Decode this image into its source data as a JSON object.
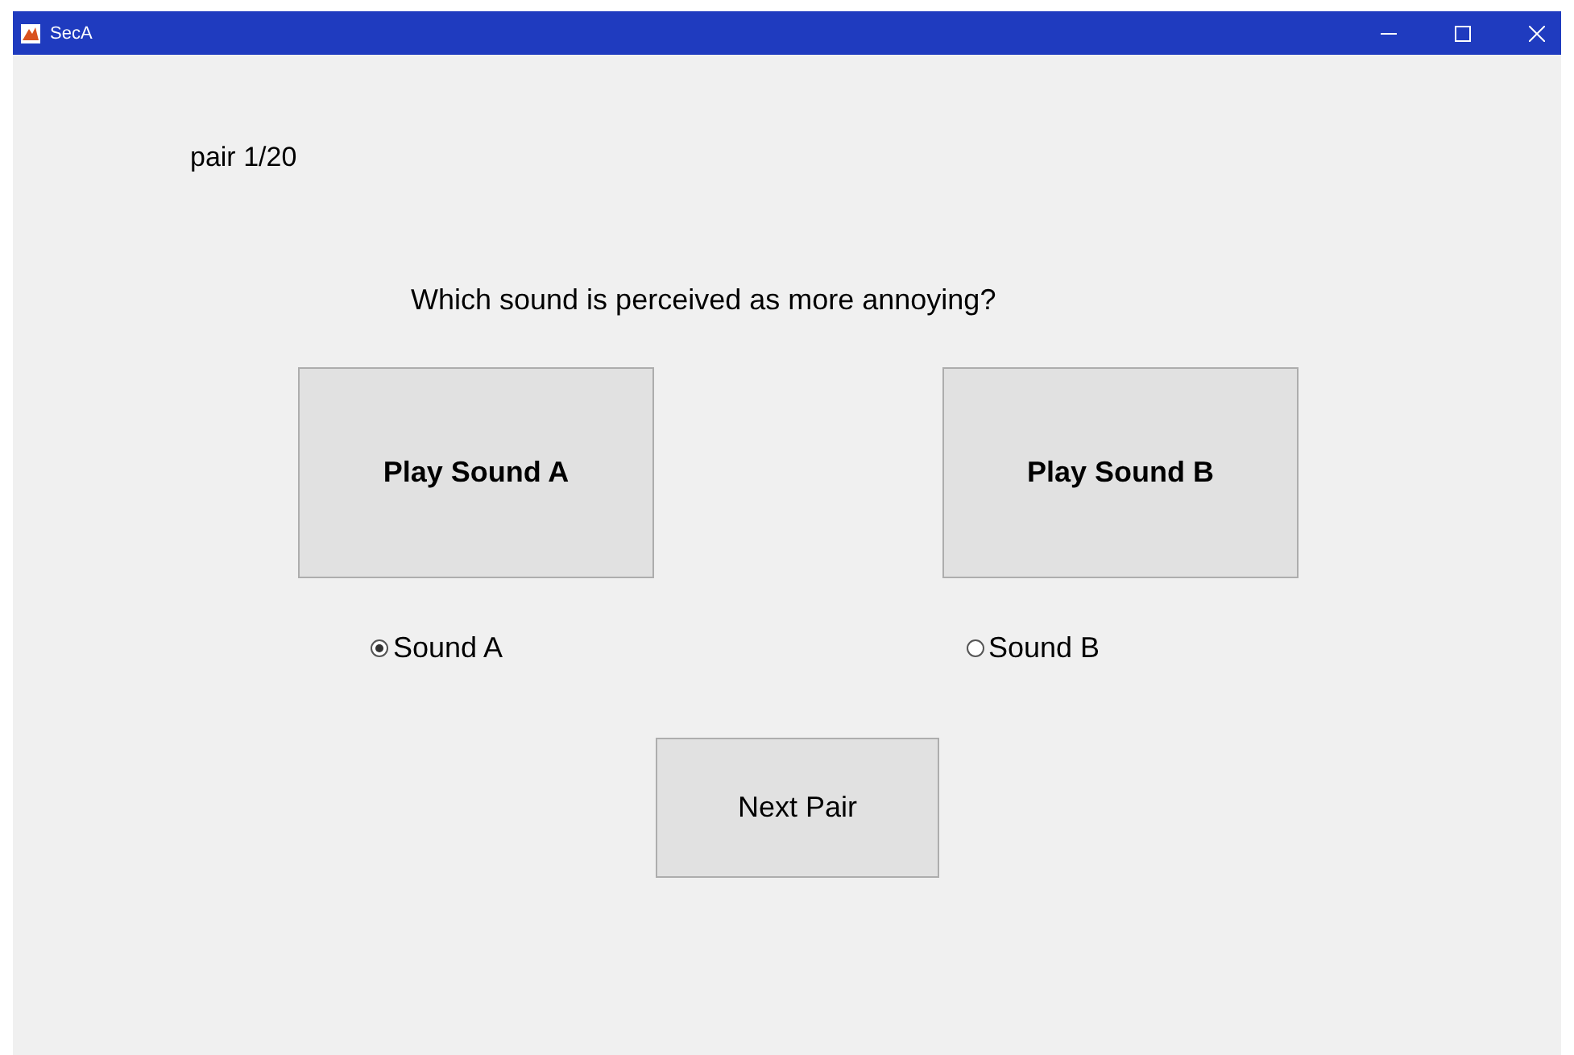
{
  "window": {
    "title": "SecA"
  },
  "progress": "pair 1/20",
  "question": "Which sound is perceived as more annoying?",
  "play_buttons": [
    "Play Sound A",
    "Play Sound B"
  ],
  "choices": [
    {
      "label": "Sound A",
      "selected": true
    },
    {
      "label": "Sound B",
      "selected": false
    }
  ],
  "next_button": "Next Pair"
}
